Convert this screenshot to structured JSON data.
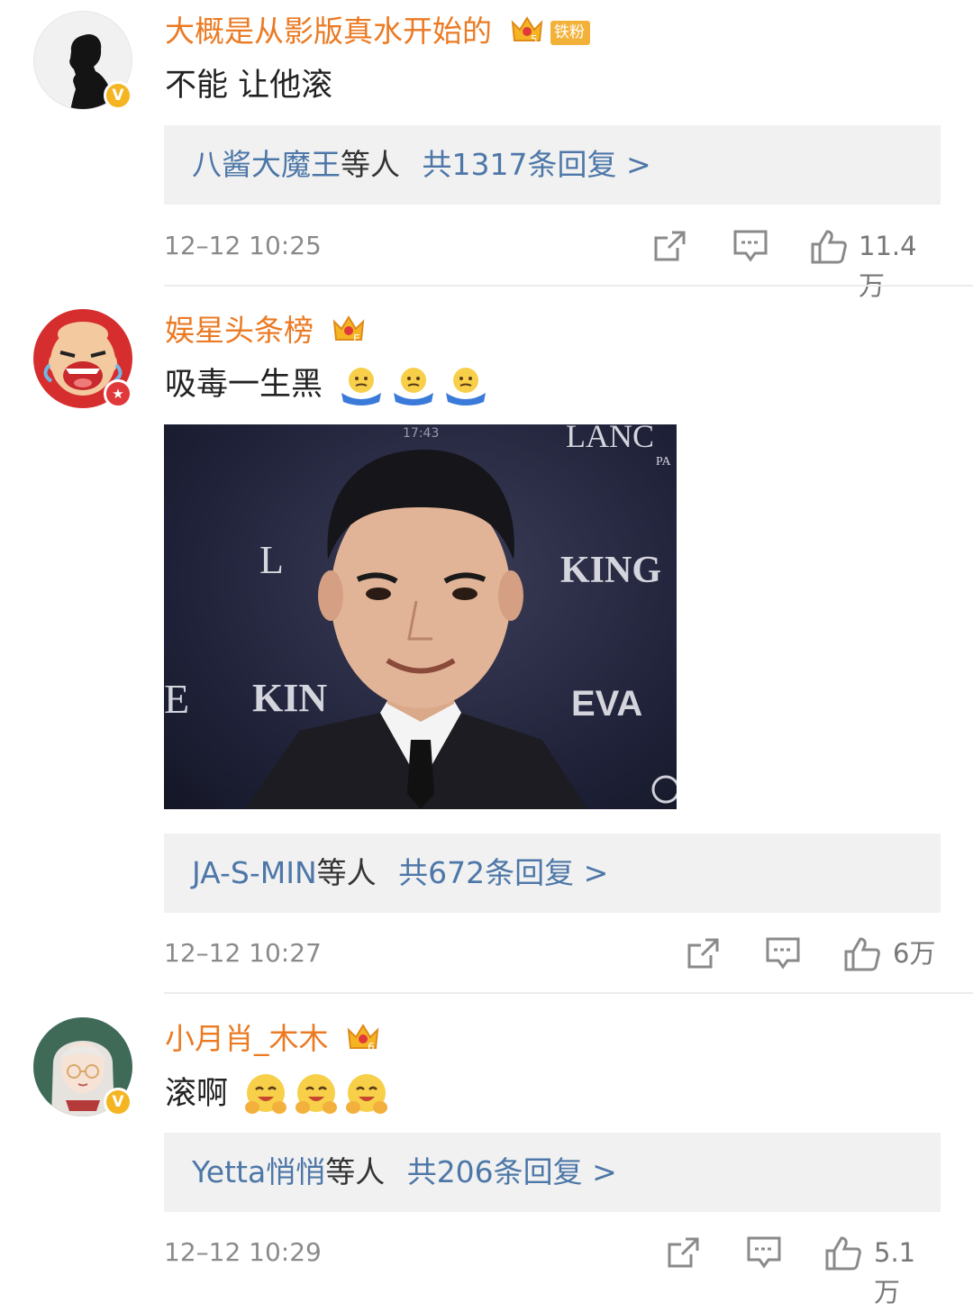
{
  "comments": [
    {
      "username": "大概是从影版真水开始的",
      "crown_level": "5",
      "fan_badge": "铁粉",
      "text": "不能 让他滚",
      "verified": "V",
      "reply_preview": {
        "users": "八酱大魔王",
        "middle": "等人",
        "count": "共1317条回复 >"
      },
      "time": "12–12 10:25",
      "likes": "11.4万"
    },
    {
      "username": "娱星头条榜",
      "crown_level": "E",
      "text": "吸毒一生黑",
      "verified": "★",
      "reply_preview": {
        "users": "JA-S-MIN",
        "middle": "等人",
        "count": "共672条回复 >"
      },
      "time": "12–12 10:27",
      "likes": "6万"
    },
    {
      "username": "小月肖_木木",
      "crown_level": "6",
      "text": "滚啊",
      "verified": "V",
      "reply_preview": {
        "users": "Yetta悄悄",
        "middle": "等人",
        "count": "共206条回复 >"
      },
      "time": "12–12 10:29",
      "likes": "5.1万"
    }
  ],
  "photo": {
    "watermark_time": "17:43",
    "backdrop_text": [
      "LANC",
      "PA",
      "L",
      "KING",
      "E",
      "KIN",
      "EVA"
    ]
  },
  "colors": {
    "username": "#eb7a23",
    "link_blue": "#4d77a8",
    "reply_bg": "#f1f1f1",
    "verified_gold": "#f5b523",
    "verified_red": "#e0383b"
  },
  "icons": [
    "crown-icon",
    "shield-badge-icon",
    "share-icon",
    "comment-icon",
    "thumbs-up-icon",
    "shrug-emoji",
    "hug-emoji"
  ]
}
